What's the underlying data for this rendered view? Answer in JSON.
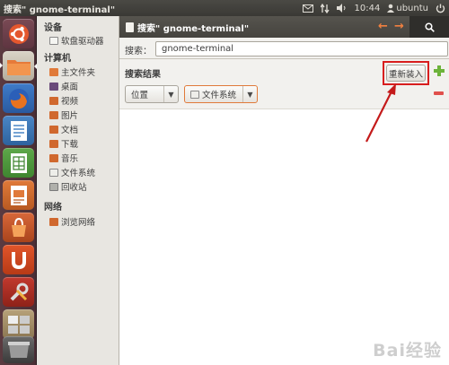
{
  "top_panel": {
    "window_title": "搜索\" gnome-terminal\"",
    "time": "10:44",
    "user": "ubuntu"
  },
  "launcher": {
    "items": [
      "ubuntu-logo-icon",
      "files-icon",
      "firefox-icon",
      "writer-icon",
      "calc-icon",
      "impress-icon",
      "software-center-icon",
      "ubuntu-one-icon",
      "system-settings-icon",
      "workspaces-icon",
      "trash-icon"
    ]
  },
  "sidebar": {
    "devices_heading": "设备",
    "devices": [
      "软盘驱动器"
    ],
    "computer_heading": "计算机",
    "computer": [
      "主文件夹",
      "桌面",
      "视频",
      "图片",
      "文档",
      "下载",
      "音乐",
      "文件系统",
      "回收站"
    ],
    "network_heading": "网络",
    "network": [
      "浏览网络"
    ]
  },
  "header": {
    "tab_title": "搜索\" gnome-terminal\""
  },
  "search": {
    "label": "搜索：",
    "value": "gnome-terminal"
  },
  "results": {
    "title": "搜索结果",
    "reload_label": "重新装入",
    "location_label": "位置",
    "filesystem_label": "文件系统"
  },
  "watermark": "Bai经验",
  "colors": {
    "accent": "#e07a3a",
    "highlight_red": "#d81e1e",
    "launcher_bg": "#5b3a40"
  }
}
